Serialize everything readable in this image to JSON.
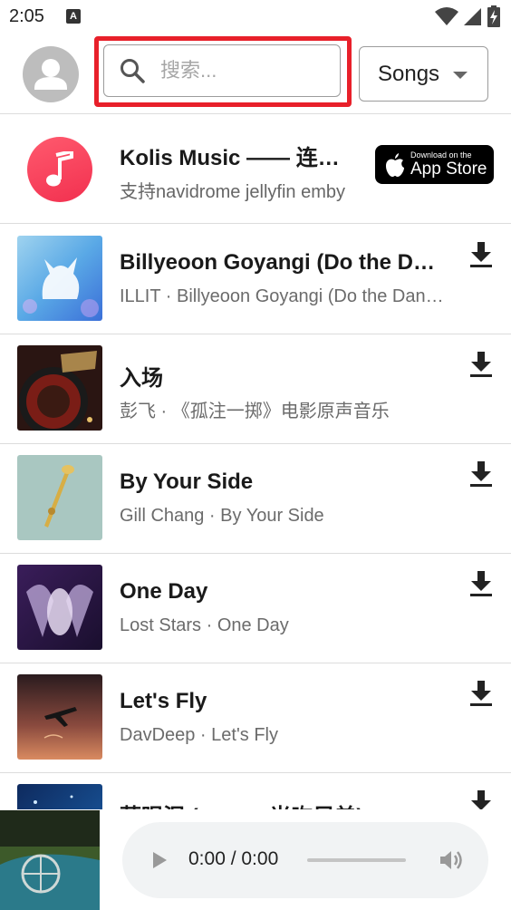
{
  "status_bar": {
    "time": "2:05",
    "notification_glyph": "A",
    "icons": [
      "wifi-icon",
      "signal-icon",
      "battery-charging-icon"
    ]
  },
  "header": {
    "search": {
      "placeholder": "搜索...",
      "value": ""
    },
    "type_select": {
      "selected": "Songs"
    }
  },
  "promo": {
    "title": "Kolis Music —— 连接音乐",
    "subtitle": "支持navidrome jellyfin emby",
    "badge": {
      "small": "Download on the",
      "big": "App Store"
    }
  },
  "songs": [
    {
      "title": "Billyeoon Goyangi (Do the Dance)",
      "artist": "ILLIT",
      "album": "Billyeoon Goyangi (Do the Dance)",
      "meta": "ILLIT · Billyeoon Goyangi (Do the Dance)"
    },
    {
      "title": "入场",
      "artist": "彭飞",
      "album": "《孤注一掷》电影原声音乐",
      "meta": "彭飞 · 《孤注一掷》电影原声音乐"
    },
    {
      "title": "By Your Side",
      "artist": "Gill Chang",
      "album": "By Your Side",
      "meta": "Gill Chang · By Your Side"
    },
    {
      "title": "One Day",
      "artist": "Lost Stars",
      "album": "One Day",
      "meta": "Lost Stars · One Day"
    },
    {
      "title": "Let's Fly",
      "artist": "DavDeep",
      "album": "Let's Fly",
      "meta": "DavDeep · Let's Fly"
    },
    {
      "title": "蓝眼泪 (cover: 光吻兄弟)",
      "artist": "",
      "album": "",
      "meta": ""
    }
  ],
  "player": {
    "time": "0:00 / 0:00",
    "progress": 0
  },
  "colors": {
    "highlight": "#e8202a",
    "promo_icon": "#f2304f",
    "divider": "#dcdcdc"
  }
}
